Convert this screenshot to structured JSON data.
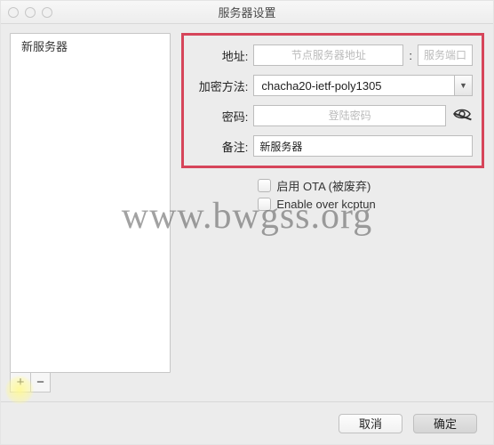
{
  "window": {
    "title": "服务器设置"
  },
  "sidebar": {
    "items": [
      "新服务器"
    ],
    "add": "+",
    "remove": "−"
  },
  "form": {
    "address": {
      "label": "地址:",
      "placeholder": "节点服务器地址",
      "port_placeholder": "服务端口"
    },
    "method": {
      "label": "加密方法:",
      "value": "chacha20-ietf-poly1305"
    },
    "password": {
      "label": "密码:",
      "placeholder": "登陆密码"
    },
    "remark": {
      "label": "备注:",
      "value": "新服务器"
    }
  },
  "checks": {
    "ota": "启用 OTA (被废弃)",
    "kcptun": "Enable over kcptun"
  },
  "footer": {
    "cancel": "取消",
    "ok": "确定"
  },
  "watermark": "www.bwgss.org"
}
